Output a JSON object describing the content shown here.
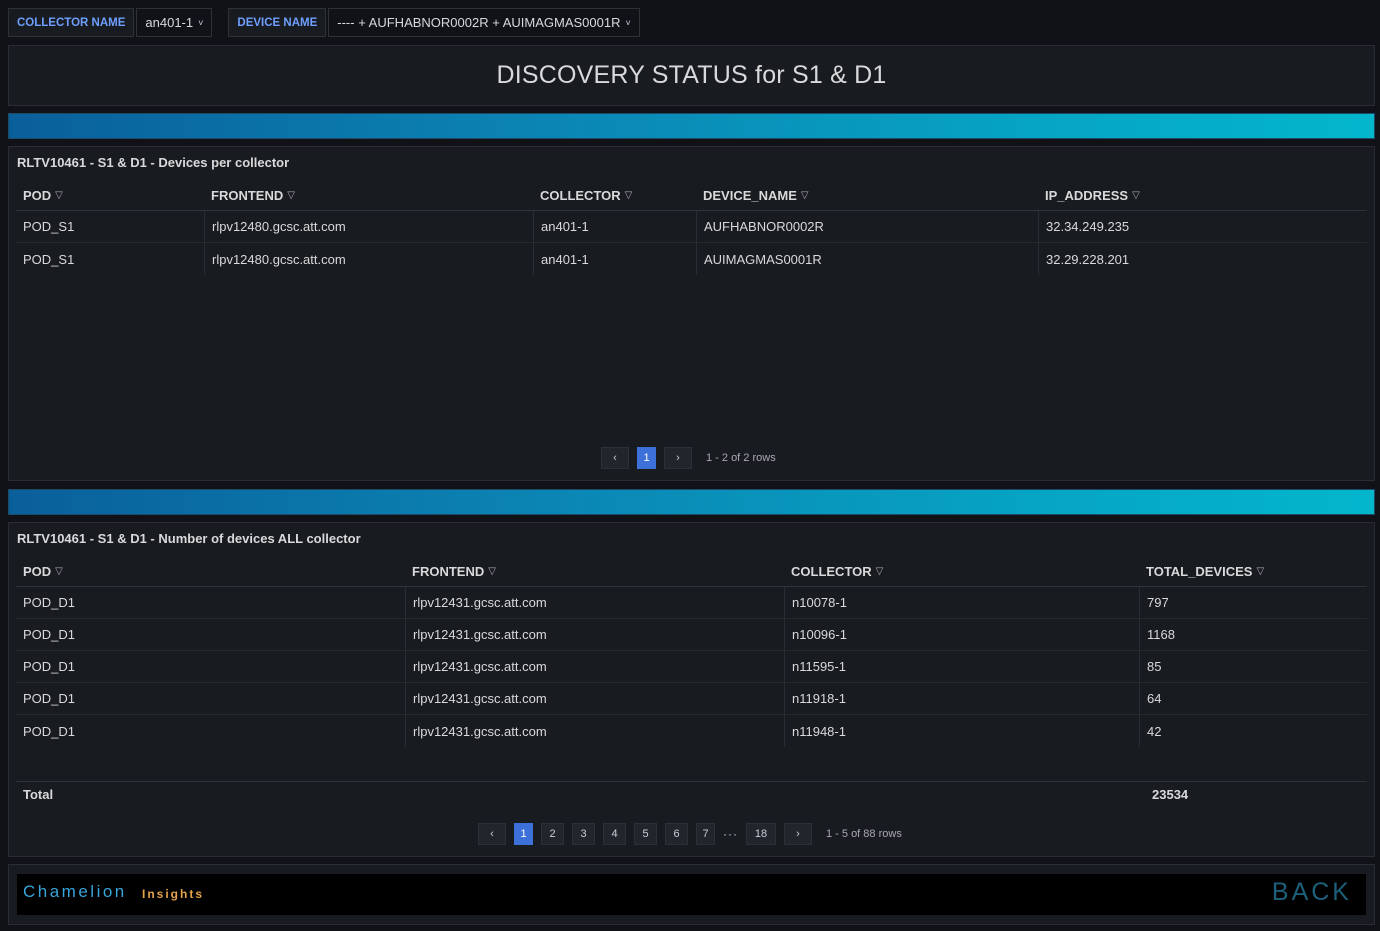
{
  "variables": {
    "collector_label": "COLLECTOR NAME",
    "collector_value": "an401-1",
    "device_label": "DEVICE NAME",
    "device_value": "---- + AUFHABNOR0002R + AUIMAGMAS0001R",
    "chevron": "˅"
  },
  "title_panel": {
    "text": "DISCOVERY STATUS for S1 & D1"
  },
  "table1": {
    "title": "RLTV10461 - S1 & D1 - Devices per collector",
    "columns": [
      "POD",
      "FRONTEND",
      "COLLECTOR",
      "DEVICE_NAME",
      "IP_ADDRESS"
    ],
    "rows": [
      [
        "POD_S1",
        "rlpv12480.gcsc.att.com",
        "an401-1",
        "AUFHABNOR0002R",
        "32.34.249.235"
      ],
      [
        "POD_S1",
        "rlpv12480.gcsc.att.com",
        "an401-1",
        "AUIMAGMAS0001R",
        "32.29.228.201"
      ]
    ],
    "pagination": {
      "prev": "‹",
      "next": "›",
      "pages": [
        "1"
      ],
      "info": "1 - 2 of 2 rows"
    }
  },
  "table2": {
    "title": "RLTV10461 - S1 & D1 - Number of devices ALL collector",
    "columns": [
      "POD",
      "FRONTEND",
      "COLLECTOR",
      "TOTAL_DEVICES"
    ],
    "rows": [
      [
        "POD_D1",
        "rlpv12431.gcsc.att.com",
        "n10078-1",
        "797"
      ],
      [
        "POD_D1",
        "rlpv12431.gcsc.att.com",
        "n10096-1",
        "1168"
      ],
      [
        "POD_D1",
        "rlpv12431.gcsc.att.com",
        "n11595-1",
        "85"
      ],
      [
        "POD_D1",
        "rlpv12431.gcsc.att.com",
        "n11918-1",
        "64"
      ],
      [
        "POD_D1",
        "rlpv12431.gcsc.att.com",
        "n11948-1",
        "42"
      ]
    ],
    "total_label": "Total",
    "total_value": "23534",
    "pagination": {
      "prev": "‹",
      "next": "›",
      "pages": [
        "1",
        "2",
        "3",
        "4",
        "5",
        "6",
        "7"
      ],
      "dots": "···",
      "last": "18",
      "info": "1 - 5 of 88 rows"
    }
  },
  "footer": {
    "brand_main": "Chamelion",
    "brand_sub": "Insights",
    "back_label": "BACK"
  },
  "colors": {
    "accent": "#3d71d9",
    "label_blue": "#6e9fff",
    "brand_blue": "#37a5d8",
    "brand_orange": "#e4a34a"
  }
}
